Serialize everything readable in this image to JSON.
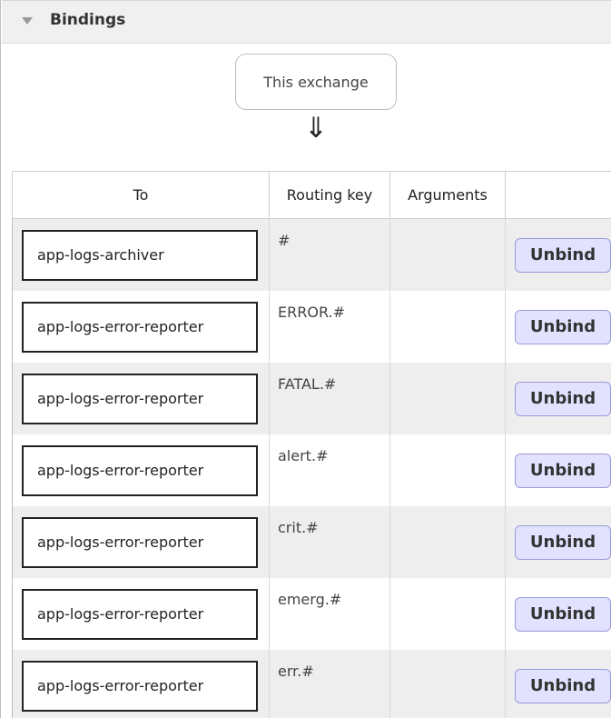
{
  "section": {
    "title": "Bindings",
    "expanded_icon": "triangle-down-icon"
  },
  "exchange": {
    "label": "This exchange",
    "arrow_icon": "double-down-arrow-icon",
    "arrow_glyph": "⇓"
  },
  "table": {
    "headers": [
      "To",
      "Routing key",
      "Arguments",
      ""
    ],
    "rows": [
      {
        "to": "app-logs-archiver",
        "routing_key": "#",
        "arguments": "",
        "action": "Unbind"
      },
      {
        "to": "app-logs-error-reporter",
        "routing_key": "ERROR.#",
        "arguments": "",
        "action": "Unbind"
      },
      {
        "to": "app-logs-error-reporter",
        "routing_key": "FATAL.#",
        "arguments": "",
        "action": "Unbind"
      },
      {
        "to": "app-logs-error-reporter",
        "routing_key": "alert.#",
        "arguments": "",
        "action": "Unbind"
      },
      {
        "to": "app-logs-error-reporter",
        "routing_key": "crit.#",
        "arguments": "",
        "action": "Unbind"
      },
      {
        "to": "app-logs-error-reporter",
        "routing_key": "emerg.#",
        "arguments": "",
        "action": "Unbind"
      },
      {
        "to": "app-logs-error-reporter",
        "routing_key": "err.#",
        "arguments": "",
        "action": "Unbind"
      }
    ]
  },
  "colors": {
    "button_bg": "#e2e2ff",
    "button_border": "#9b9bd9",
    "row_shaded": "#eeeeee",
    "header_bg": "#f0f0f0"
  }
}
